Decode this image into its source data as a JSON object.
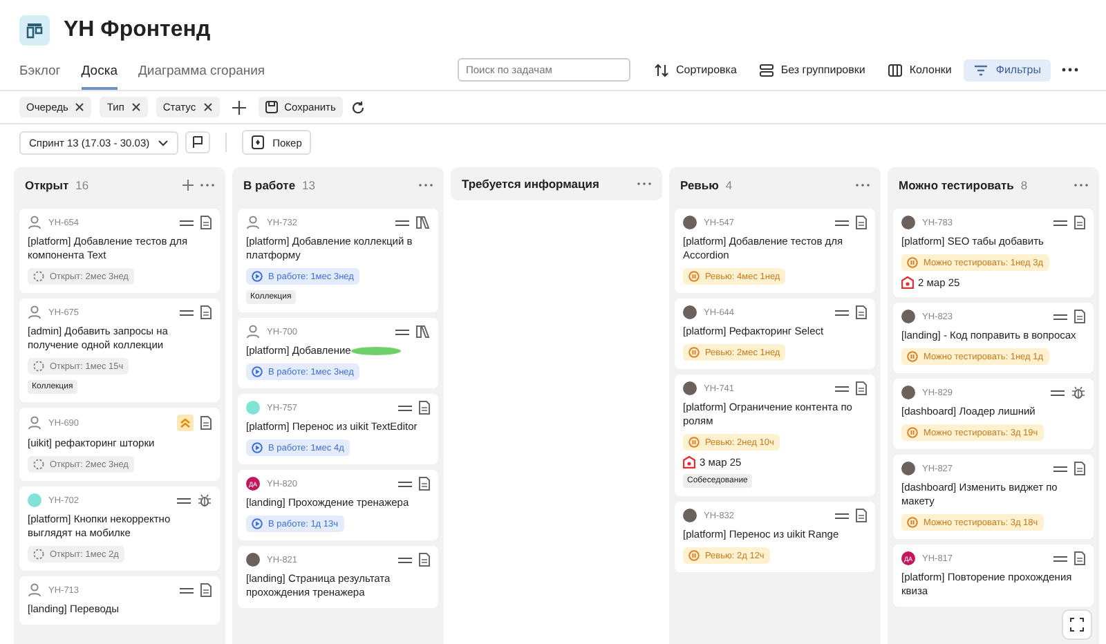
{
  "header": {
    "title": "YH Фронтенд"
  },
  "tabs": [
    {
      "label": "Бэклог",
      "selected": false
    },
    {
      "label": "Доска",
      "selected": true
    },
    {
      "label": "Диаграмма сгорания",
      "selected": false
    }
  ],
  "search": {
    "placeholder": "Поиск по задачам"
  },
  "toolbar": [
    {
      "kind": "sort",
      "label": "Сортировка",
      "selected": false
    },
    {
      "kind": "group",
      "label": "Без группировки",
      "selected": false
    },
    {
      "kind": "columns",
      "label": "Колонки",
      "selected": false
    },
    {
      "kind": "filter",
      "label": "Фильтры",
      "selected": true
    }
  ],
  "filters": [
    {
      "label": "Очередь"
    },
    {
      "label": "Тип"
    },
    {
      "label": "Статус"
    }
  ],
  "save_button": "Сохранить",
  "sprint": {
    "label": "Спринт 13 (17.03 - 30.03)"
  },
  "poker_button": "Покер",
  "columns": [
    {
      "title": "Открыт",
      "count": "16",
      "can_add": true,
      "cards": [
        {
          "id": "YH-654",
          "avatar": {
            "kind": "person"
          },
          "priority": {
            "kind": "normal"
          },
          "issue_type": {
            "kind": "task"
          },
          "title": "[platform] Добавление тестов для компонента Text",
          "status": {
            "kind": "open",
            "text": "Открыт: 2мес 3нед"
          }
        },
        {
          "id": "YH-675",
          "avatar": {
            "kind": "person"
          },
          "priority": {
            "kind": "normal"
          },
          "issue_type": {
            "kind": "task"
          },
          "title": "[admin] Добавить запросы на получение одной коллекции",
          "status": {
            "kind": "open",
            "text": "Открыт: 1мес 15ч"
          },
          "tag": "Коллекция"
        },
        {
          "id": "YH-690",
          "avatar": {
            "kind": "person"
          },
          "priority": {
            "kind": "high"
          },
          "issue_type": {
            "kind": "task"
          },
          "title": "[uikit] рефакторинг шторки",
          "status": {
            "kind": "open",
            "text": "Открыт: 2мес 3нед"
          }
        },
        {
          "id": "YH-702",
          "avatar": {
            "kind": "teal"
          },
          "priority": {
            "kind": "normal"
          },
          "issue_type": {
            "kind": "bug"
          },
          "title": "[platform] Кнопки некорректно выглядят на мобилке",
          "status": {
            "kind": "open",
            "text": "Открыт: 1мес 2д"
          }
        },
        {
          "id": "YH-713",
          "avatar": {
            "kind": "person"
          },
          "priority": {
            "kind": "normal"
          },
          "issue_type": {
            "kind": "task"
          },
          "title": "[landing] Переводы"
        }
      ]
    },
    {
      "title": "В работе",
      "count": "13",
      "can_add": false,
      "cards": [
        {
          "id": "YH-732",
          "avatar": {
            "kind": "person"
          },
          "priority": {
            "kind": "normal"
          },
          "issue_type": {
            "kind": "story"
          },
          "title": "[platform] Добавление коллекций в платформу",
          "status": {
            "kind": "progress",
            "text": "В работе: 1мес 3нед"
          },
          "tag": "Коллекция"
        },
        {
          "id": "YH-700",
          "avatar": {
            "kind": "person"
          },
          "priority": {
            "kind": "normal"
          },
          "issue_type": {
            "kind": "story"
          },
          "title": "[platform] Добавление",
          "redacted": true,
          "status": {
            "kind": "progress",
            "text": "В работе: 1мес 3нед"
          }
        },
        {
          "id": "YH-757",
          "avatar": {
            "kind": "teal"
          },
          "priority": {
            "kind": "normal"
          },
          "issue_type": {
            "kind": "task"
          },
          "title": "[platform] Перенос из uikit TextEditor",
          "status": {
            "kind": "progress",
            "text": "В работе: 1мес 4д"
          }
        },
        {
          "id": "YH-820",
          "avatar": {
            "kind": "initials",
            "text": "ДА"
          },
          "priority": {
            "kind": "normal"
          },
          "issue_type": {
            "kind": "task"
          },
          "title": "[landing] Прохождение тренажера",
          "status": {
            "kind": "progress",
            "text": "В работе: 1д 13ч"
          }
        },
        {
          "id": "YH-821",
          "avatar": {
            "kind": "photo"
          },
          "priority": {
            "kind": "normal"
          },
          "issue_type": {
            "kind": "task"
          },
          "title": "[landing] Страница результата прохождения тренажера"
        }
      ]
    },
    {
      "title": "Требуется информация",
      "can_add": false
    },
    {
      "title": "Ревью",
      "count": "4",
      "can_add": false,
      "cards": [
        {
          "id": "YH-547",
          "avatar": {
            "kind": "photo"
          },
          "priority": {
            "kind": "normal"
          },
          "issue_type": {
            "kind": "task"
          },
          "title": "[platform] Добавление тестов для Accordion",
          "status": {
            "kind": "review",
            "text": "Ревью: 4мес 1нед"
          }
        },
        {
          "id": "YH-644",
          "avatar": {
            "kind": "photo"
          },
          "priority": {
            "kind": "normal"
          },
          "issue_type": {
            "kind": "task"
          },
          "title": "[platform] Рефакторинг Select",
          "status": {
            "kind": "review",
            "text": "Ревью: 2мес 1нед"
          }
        },
        {
          "id": "YH-741",
          "avatar": {
            "kind": "photo"
          },
          "priority": {
            "kind": "normal"
          },
          "issue_type": {
            "kind": "task"
          },
          "title": "[platform] Ограничение контента по ролям",
          "status": {
            "kind": "review",
            "text": "Ревью: 2нед 10ч"
          },
          "deadline": "3 мар 25",
          "tag": "Собеседование"
        },
        {
          "id": "YH-832",
          "avatar": {
            "kind": "photo"
          },
          "priority": {
            "kind": "normal"
          },
          "issue_type": {
            "kind": "task"
          },
          "title": "[platform] Перенос из uikit Range",
          "status": {
            "kind": "review",
            "text": "Ревью: 2д 12ч"
          }
        }
      ]
    },
    {
      "title": "Можно тестировать",
      "count": "8",
      "can_add": false,
      "cards": [
        {
          "id": "YH-783",
          "avatar": {
            "kind": "photo"
          },
          "priority": {
            "kind": "normal"
          },
          "issue_type": {
            "kind": "task"
          },
          "title": "[platform] SEO табы добавить",
          "status": {
            "kind": "review",
            "text": "Можно тестировать: 1нед 3д"
          },
          "deadline": "2 мар 25"
        },
        {
          "id": "YH-823",
          "avatar": {
            "kind": "photo"
          },
          "priority": {
            "kind": "normal"
          },
          "issue_type": {
            "kind": "task"
          },
          "title": "[landing] - Код поправить в вопросах",
          "status": {
            "kind": "review",
            "text": "Можно тестировать: 1нед 1д"
          }
        },
        {
          "id": "YH-829",
          "avatar": {
            "kind": "photo"
          },
          "priority": {
            "kind": "normal"
          },
          "issue_type": {
            "kind": "bug"
          },
          "title": "[dashboard] Лоадер лишний",
          "status": {
            "kind": "review",
            "text": "Можно тестировать: 3д 19ч"
          }
        },
        {
          "id": "YH-827",
          "avatar": {
            "kind": "photo"
          },
          "priority": {
            "kind": "normal"
          },
          "issue_type": {
            "kind": "task"
          },
          "title": "[dashboard] Изменить виджет по макету",
          "status": {
            "kind": "review",
            "text": "Можно тестировать: 3д 18ч"
          }
        },
        {
          "id": "YH-817",
          "avatar": {
            "kind": "initials",
            "text": "ДА"
          },
          "priority": {
            "kind": "normal"
          },
          "issue_type": {
            "kind": "task"
          },
          "title": "[platform] Повторение прохождения квиза"
        }
      ]
    }
  ]
}
